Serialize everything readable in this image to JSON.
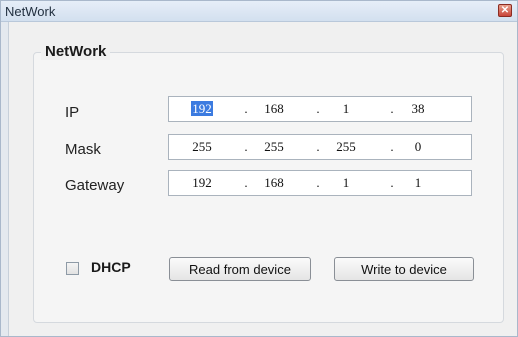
{
  "window": {
    "title": "NetWork",
    "close_glyph": "✕"
  },
  "group": {
    "legend": "NetWork"
  },
  "fields": {
    "ip": {
      "label": "IP",
      "octets": [
        "192",
        "168",
        "1",
        "38"
      ]
    },
    "mask": {
      "label": "Mask",
      "octets": [
        "255",
        "255",
        "255",
        "0"
      ]
    },
    "gateway": {
      "label": "Gateway",
      "octets": [
        "192",
        "168",
        "1",
        "1"
      ]
    },
    "separator": "."
  },
  "dhcp": {
    "label": "DHCP",
    "checked": false
  },
  "buttons": {
    "read": "Read from device",
    "write": "Write to device"
  },
  "colors": {
    "selection": "#3c7be0",
    "close": "#c9453a"
  }
}
